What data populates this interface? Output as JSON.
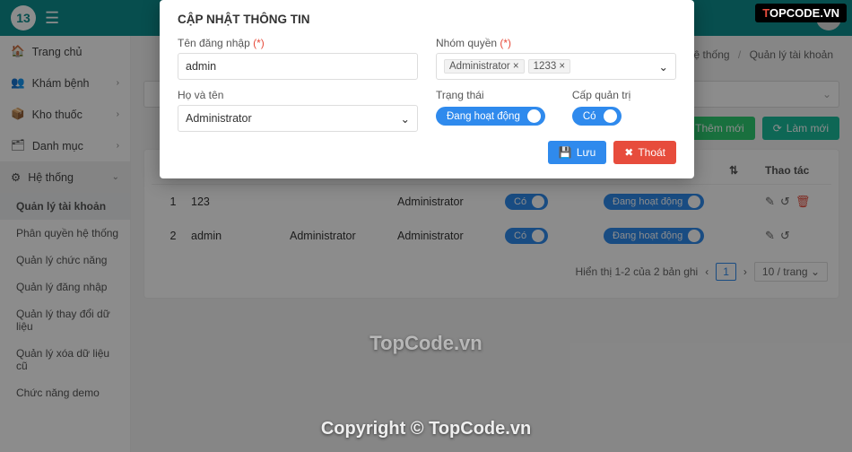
{
  "brand_badge": {
    "prefix": "T",
    "rest": "OPCODE.VN"
  },
  "topbar": {
    "logo_text": "13"
  },
  "sidebar": {
    "items": [
      {
        "icon": "🏠",
        "label": "Trang chủ",
        "chev": ""
      },
      {
        "icon": "👥",
        "label": "Khám bệnh",
        "chev": "›"
      },
      {
        "icon": "📦",
        "label": "Kho thuốc",
        "chev": "›"
      },
      {
        "icon": "🗂",
        "label": "Danh mục",
        "chev": "›"
      },
      {
        "icon": "⚙",
        "label": "Hệ thống",
        "chev": "⌄"
      }
    ],
    "subs": [
      "Quản lý tài khoản",
      "Phân quyền hệ thống",
      "Quản lý chức năng",
      "Quản lý đăng nhập",
      "Quản lý thay đổi dữ liệu",
      "Quản lý xóa dữ liệu cũ",
      "Chức năng demo"
    ]
  },
  "breadcrumb": {
    "a": "Hệ thống",
    "b": "Quản lý tài khoản",
    "sep": "/"
  },
  "buttons": {
    "add": "Thêm mới",
    "refresh": "Làm mới",
    "save": "Lưu",
    "exit": "Thoát"
  },
  "table": {
    "head_act": "Thao tác",
    "rows": [
      {
        "idx": "1",
        "user": "123",
        "name": "",
        "role": "Administrator",
        "admin": "Có",
        "status": "Đang hoạt động"
      },
      {
        "idx": "2",
        "user": "admin",
        "name": "Administrator",
        "role": "Administrator",
        "admin": "Có",
        "status": "Đang hoạt động"
      }
    ],
    "pager_text": "Hiển thị 1-2 của 2 bản ghi",
    "page": "1",
    "perpage": "10 / trang"
  },
  "modal": {
    "title": "CẬP NHẬT THÔNG TIN",
    "f_user": "Tên đăng nhập",
    "v_user": "admin",
    "f_role": "Nhóm quyền",
    "tags": [
      "Administrator ×",
      "1233 ×"
    ],
    "f_name": "Họ và tên",
    "v_name": "Administrator",
    "f_status": "Trạng thái",
    "v_status": "Đang hoạt động",
    "f_admin": "Cấp quản trị",
    "v_admin": "Có"
  },
  "watermark1": "TopCode.vn",
  "watermark2": "Copyright © TopCode.vn"
}
